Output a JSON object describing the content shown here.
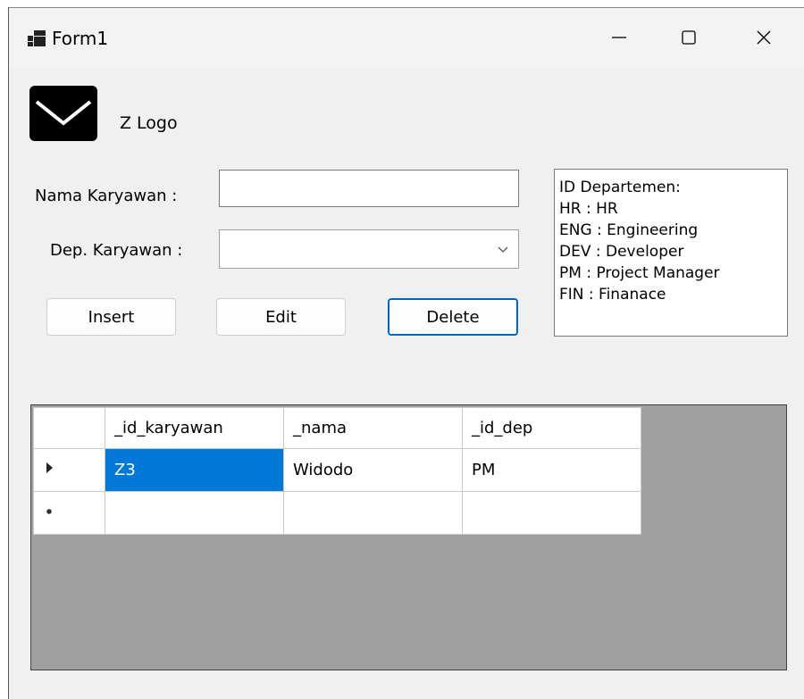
{
  "window": {
    "title": "Form1"
  },
  "logo": {
    "text": "Z Logo"
  },
  "form": {
    "nama_label": "Nama Karyawan :",
    "nama_value": "",
    "dep_label": "Dep. Karyawan :",
    "dep_selected": ""
  },
  "buttons": {
    "insert": "Insert",
    "edit": "Edit",
    "delete": "Delete"
  },
  "info": {
    "lines": [
      "ID Departemen:",
      "HR : HR",
      "ENG : Engineering",
      "DEV : Developer",
      "PM : Project Manager",
      "FIN : Finanace"
    ]
  },
  "grid": {
    "columns": [
      "_id_karyawan",
      "_nama",
      "_id_dep"
    ],
    "rows": [
      [
        "Z3",
        "Widodo",
        "PM"
      ]
    ]
  },
  "colors": {
    "selection": "#0078d7",
    "focus_border": "#0067c0",
    "grid_background": "#a0a0a0"
  }
}
